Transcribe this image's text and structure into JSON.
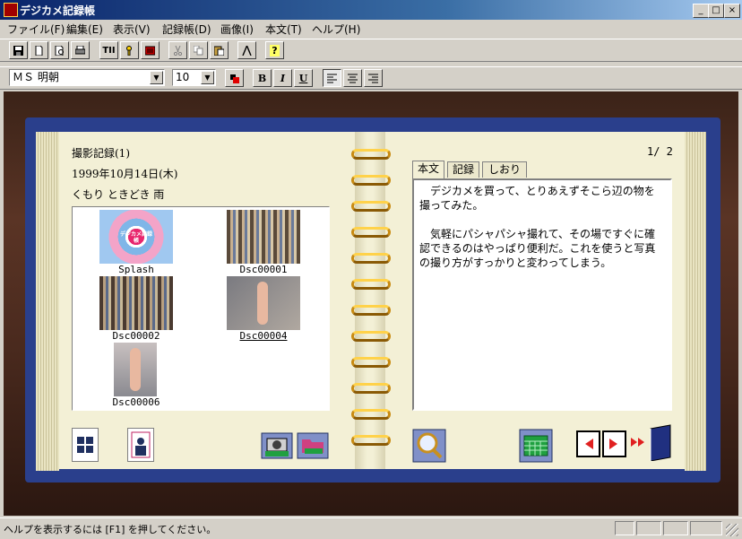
{
  "window": {
    "title": "デジカメ記録帳",
    "min": "_",
    "max": "□",
    "close": "×"
  },
  "menu": [
    "ファイル(F)",
    "編集(E)",
    "表示(V)",
    "記録帳(D)",
    "画像(I)",
    "本文(T)",
    "ヘルプ(H)"
  ],
  "toolbar2": {
    "font": "ＭＳ 明朝",
    "size": "10",
    "bold": "B",
    "italic": "I",
    "underline": "U",
    "tii": "TII",
    "help": "?"
  },
  "page_left": {
    "header": "撮影記録(1)",
    "date": "1999年10月14日(木)",
    "weather": "くもり ときどき 雨",
    "thumbs": [
      "Splash",
      "Dsc00001",
      "Dsc00002",
      "Dsc00004",
      "Dsc00006"
    ],
    "splash_label": "デジカメ記録帳"
  },
  "page_right": {
    "page_num": "1/ 2",
    "tabs": [
      "本文",
      "記録",
      "しおり"
    ],
    "note": "　デジカメを買って、とりあえずそこら辺の物を撮ってみた。\n\n　気軽にパシャパシャ撮れて、その場ですぐに確認できるのはやっぱり便利だ。これを使うと写真の撮り方がすっかりと変わってしまう。"
  },
  "status": {
    "text": "ヘルプを表示するには [F1] を押してください。"
  },
  "colors": {
    "cover": "#2a3f8c",
    "page": "#f3f0d6",
    "ring": "#c88a10",
    "title_bar": "#0a246a"
  }
}
